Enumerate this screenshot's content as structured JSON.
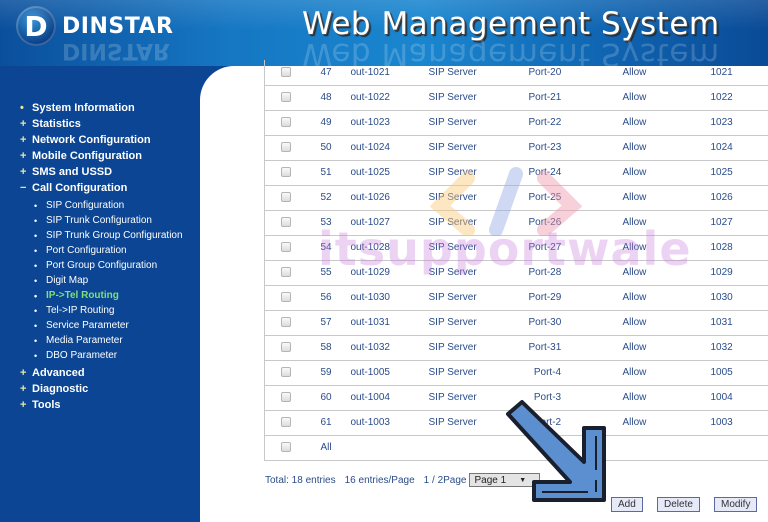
{
  "header": {
    "brand": "DINSTAR",
    "logo_glyph": "D",
    "title": "Web Management System"
  },
  "sidebar": {
    "items": [
      {
        "symbol": "•",
        "label": "System Information"
      },
      {
        "symbol": "+",
        "label": "Statistics"
      },
      {
        "symbol": "+",
        "label": "Network Configuration"
      },
      {
        "symbol": "+",
        "label": "Mobile Configuration"
      },
      {
        "symbol": "+",
        "label": "SMS and USSD"
      },
      {
        "symbol": "−",
        "label": "Call Configuration"
      }
    ],
    "call_configuration_sub": [
      {
        "label": "SIP Configuration"
      },
      {
        "label": "SIP Trunk Configuration"
      },
      {
        "label": "SIP Trunk Group Configuration"
      },
      {
        "label": "Port Configuration"
      },
      {
        "label": "Port Group Configuration"
      },
      {
        "label": "Digit Map"
      },
      {
        "label": "IP->Tel Routing",
        "active": true
      },
      {
        "label": "Tel->IP Routing"
      },
      {
        "label": "Service Parameter"
      },
      {
        "label": "Media Parameter"
      },
      {
        "label": "DBO Parameter"
      }
    ],
    "items_after": [
      {
        "symbol": "+",
        "label": "Advanced"
      },
      {
        "symbol": "+",
        "label": "Diagnostic"
      },
      {
        "symbol": "+",
        "label": "Tools"
      }
    ],
    "sub_bullet": "•",
    "active_color": "#7ee07a"
  },
  "routes": {
    "rows": [
      {
        "index": "47",
        "name": "out-1021",
        "dest": "SIP Server",
        "port": "Port-20",
        "action": "Allow",
        "number": "1021"
      },
      {
        "index": "48",
        "name": "out-1022",
        "dest": "SIP Server",
        "port": "Port-21",
        "action": "Allow",
        "number": "1022"
      },
      {
        "index": "49",
        "name": "out-1023",
        "dest": "SIP Server",
        "port": "Port-22",
        "action": "Allow",
        "number": "1023"
      },
      {
        "index": "50",
        "name": "out-1024",
        "dest": "SIP Server",
        "port": "Port-23",
        "action": "Allow",
        "number": "1024"
      },
      {
        "index": "51",
        "name": "out-1025",
        "dest": "SIP Server",
        "port": "Port-24",
        "action": "Allow",
        "number": "1025"
      },
      {
        "index": "52",
        "name": "out-1026",
        "dest": "SIP Server",
        "port": "Port-25",
        "action": "Allow",
        "number": "1026"
      },
      {
        "index": "53",
        "name": "out-1027",
        "dest": "SIP Server",
        "port": "Port-26",
        "action": "Allow",
        "number": "1027"
      },
      {
        "index": "54",
        "name": "out-1028",
        "dest": "SIP Server",
        "port": "Port-27",
        "action": "Allow",
        "number": "1028"
      },
      {
        "index": "55",
        "name": "out-1029",
        "dest": "SIP Server",
        "port": "Port-28",
        "action": "Allow",
        "number": "1029"
      },
      {
        "index": "56",
        "name": "out-1030",
        "dest": "SIP Server",
        "port": "Port-29",
        "action": "Allow",
        "number": "1030"
      },
      {
        "index": "57",
        "name": "out-1031",
        "dest": "SIP Server",
        "port": "Port-30",
        "action": "Allow",
        "number": "1031"
      },
      {
        "index": "58",
        "name": "out-1032",
        "dest": "SIP Server",
        "port": "Port-31",
        "action": "Allow",
        "number": "1032"
      },
      {
        "index": "59",
        "name": "out-1005",
        "dest": "SIP Server",
        "port": "Port-4",
        "action": "Allow",
        "number": "1005"
      },
      {
        "index": "60",
        "name": "out-1004",
        "dest": "SIP Server",
        "port": "Port-3",
        "action": "Allow",
        "number": "1004"
      },
      {
        "index": "61",
        "name": "out-1003",
        "dest": "SIP Server",
        "port": "Port-2",
        "action": "Allow",
        "number": "1003"
      }
    ],
    "select_all_label": "All"
  },
  "pagination": {
    "total": "Total:  18 entries",
    "per_page": "16 entries/Page",
    "page_of": "1 / 2Page",
    "page_select_value": "Page 1",
    "dropdown_glyph": "▼"
  },
  "actions": {
    "add": "Add",
    "delete": "Delete",
    "modify": "Modify"
  },
  "overlay": {
    "watermark_text": "itsupportwale",
    "arrow_color": "#5b8fd0"
  }
}
